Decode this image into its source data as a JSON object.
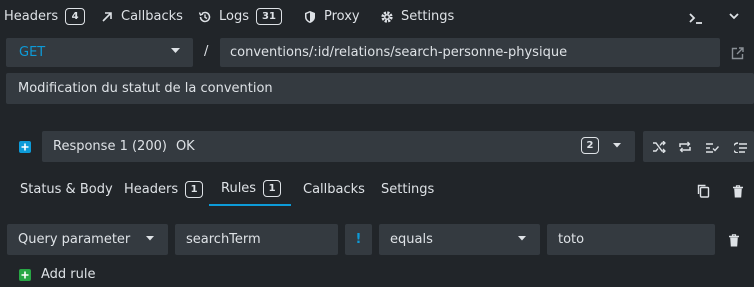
{
  "top_tabs": {
    "headers": {
      "label": "Headers",
      "count": "4"
    },
    "callbacks": {
      "label": "Callbacks"
    },
    "logs": {
      "label": "Logs",
      "count": "31"
    },
    "proxy": {
      "label": "Proxy"
    },
    "settings": {
      "label": "Settings"
    }
  },
  "route": {
    "method": "GET",
    "separator": "/",
    "path": "conventions/:id/relations/search-personne-physique",
    "description": "Modification du statut de la convention"
  },
  "response": {
    "label": "Response 1 (200)",
    "status": "OK",
    "count": "2"
  },
  "response_tabs": {
    "status_body": "Status & Body",
    "headers": {
      "label": "Headers",
      "count": "1"
    },
    "rules": {
      "label": "Rules",
      "count": "1"
    },
    "callbacks": "Callbacks",
    "settings": "Settings"
  },
  "rule": {
    "target": "Query parameter",
    "property": "searchTerm",
    "invert": "!",
    "operator": "equals",
    "value": "toto"
  },
  "add_rule_label": "Add rule",
  "colors": {
    "background": "#212529",
    "field": "#343a40",
    "accent": "#0d9bd8",
    "add_rule_green": "#28a745",
    "text": "#dee2e6"
  }
}
